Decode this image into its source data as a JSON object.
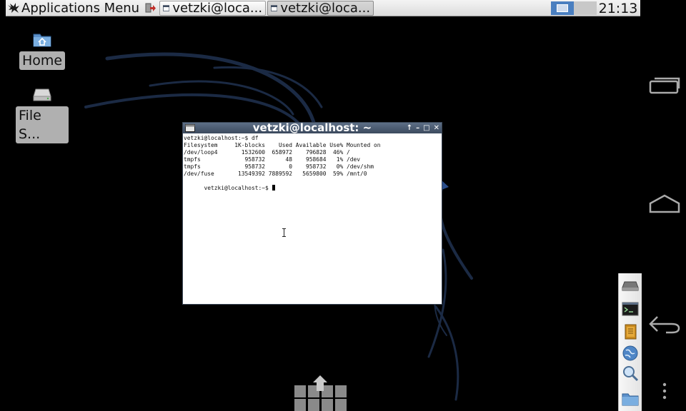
{
  "top_panel": {
    "applications_menu": "Applications Menu",
    "tasks": [
      {
        "label": "vetzki@loca...",
        "active": false
      },
      {
        "label": "vetzki@loca...",
        "active": true
      }
    ],
    "clock": "21:13"
  },
  "desktop_icons": [
    {
      "label": "Home",
      "icon": "home-folder-icon"
    },
    {
      "label": "File S...",
      "icon": "drive-icon"
    }
  ],
  "terminal": {
    "title": "vetzki@localhost: ~",
    "lines": [
      "vetzki@localhost:~$ df",
      "Filesystem     1K-blocks    Used Available Use% Mounted on",
      "/dev/loop4       1532600  658972    796828  46% /",
      "tmpfs             958732      48    958684   1% /dev",
      "tmpfs             958732       0    958732   0% /dev/shm",
      "/dev/fuse       13549392 7889592   5659800  59% /mnt/0",
      "vetzki@localhost:~$ "
    ]
  },
  "dock_items": [
    "drive-icon",
    "terminal-icon",
    "book-icon",
    "globe-icon",
    "search-icon",
    "folder-icon"
  ],
  "android_nav": [
    "recent-apps-icon",
    "home-icon",
    "back-icon",
    "overflow-menu-icon"
  ],
  "colors": {
    "panel_bg": "#e6e6e6",
    "titlebar": "#4a5a70",
    "pager_active": "#4a7fc0",
    "wallpaper_lines": "#1a2840"
  }
}
